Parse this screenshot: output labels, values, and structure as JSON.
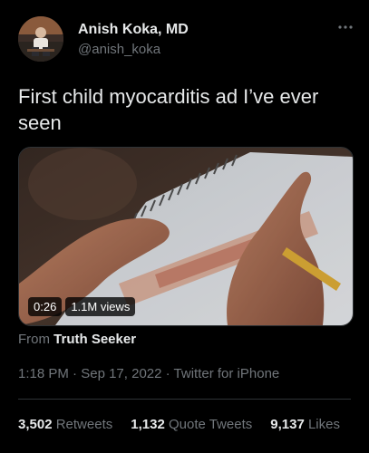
{
  "author": {
    "name": "Anish Koka, MD",
    "handle": "@anish_koka",
    "more_icon": "more-horizontal-icon"
  },
  "tweet": {
    "text": "First child myocarditis ad I’ve ever seen"
  },
  "media": {
    "duration": "0:26",
    "views": "1.1M views"
  },
  "source": {
    "prefix": "From",
    "name": "Truth Seeker"
  },
  "meta": {
    "time": "1:18 PM",
    "separator": "·",
    "date": "Sep 17, 2022",
    "app": "Twitter for iPhone"
  },
  "stats": {
    "retweets_count": "3,502",
    "retweets_label": "Retweets",
    "quotes_count": "1,132",
    "quotes_label": "Quote Tweets",
    "likes_count": "9,137",
    "likes_label": "Likes"
  },
  "colors": {
    "background": "#000000",
    "primary_text": "#e7e9ea",
    "secondary_text": "#71767b",
    "divider": "#2f3336"
  }
}
